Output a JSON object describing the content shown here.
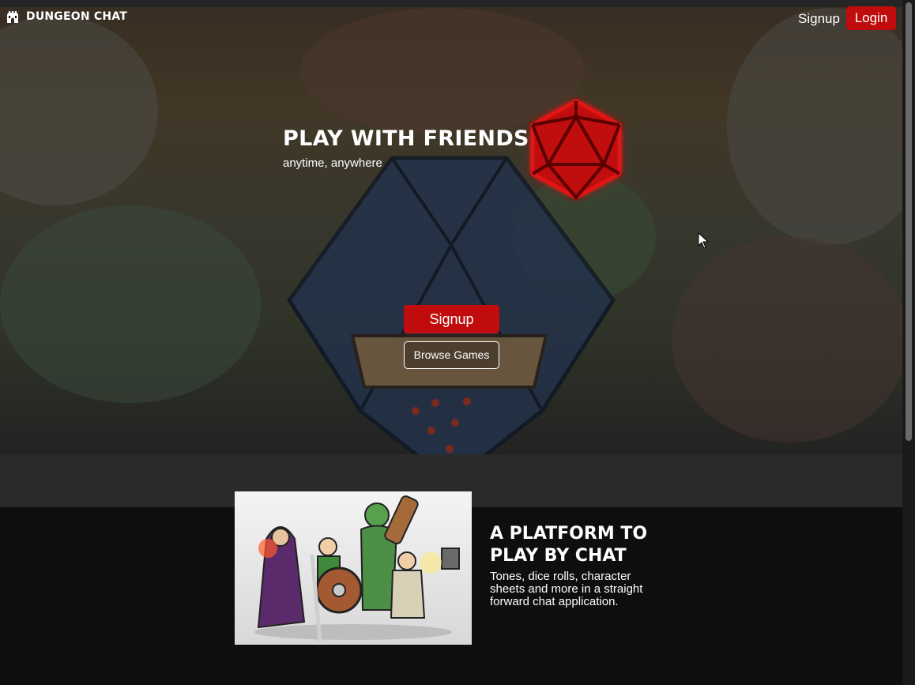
{
  "nav": {
    "brand": "DUNGEON CHAT",
    "signup_label": "Signup",
    "login_label": "Login"
  },
  "hero": {
    "title": "PLAY WITH FRIENDS",
    "subtitle": "anytime, anywhere",
    "signup_button": "Signup",
    "browse_button": "Browse Games"
  },
  "feature": {
    "title": "A PLATFORM TO PLAY BY CHAT",
    "description": "Tones, dice rolls, character sheets and more in a straight forward chat application."
  },
  "icons": {
    "logo": "castle-icon",
    "dice": "d20-icon",
    "cursor": "mouse-cursor-icon"
  },
  "colors": {
    "accent": "#c00c0c",
    "background": "#0e0e0e",
    "text": "#ffffff"
  }
}
